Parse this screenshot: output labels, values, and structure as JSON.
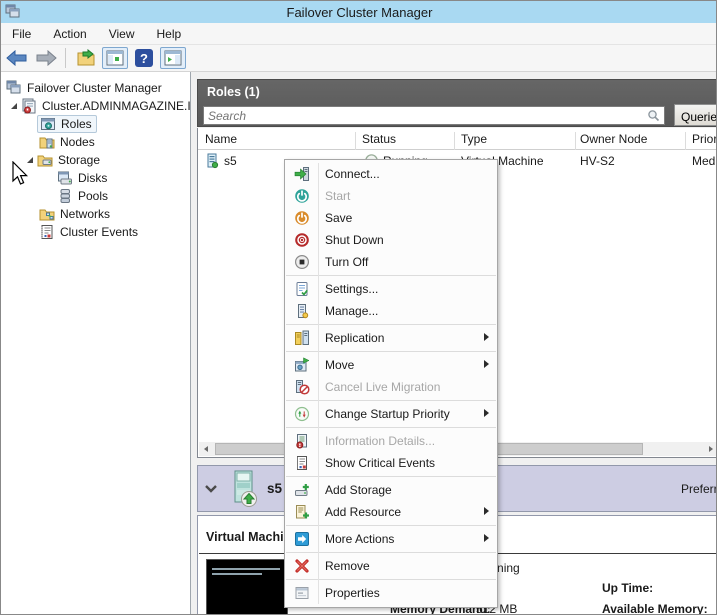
{
  "window": {
    "title": "Failover Cluster Manager"
  },
  "menubar": {
    "items": [
      {
        "label": "File"
      },
      {
        "label": "Action"
      },
      {
        "label": "View"
      },
      {
        "label": "Help"
      }
    ]
  },
  "toolbar": {
    "icon_names": [
      "back-arrow-icon",
      "forward-arrow-icon",
      "export-list-icon",
      "console-tree-icon",
      "help-icon",
      "action-pane-icon"
    ]
  },
  "tree": {
    "items": [
      {
        "label": "Failover Cluster Manager",
        "icon": "console-root-icon"
      },
      {
        "label": "Cluster.ADMINMAGAZINE.I",
        "icon": "cluster-icon",
        "expanded": true
      },
      {
        "label": "Roles",
        "icon": "roles-icon",
        "selected": true
      },
      {
        "label": "Nodes",
        "icon": "nodes-icon"
      },
      {
        "label": "Storage",
        "icon": "storage-icon",
        "expanded": true
      },
      {
        "label": "Disks",
        "icon": "disks-icon"
      },
      {
        "label": "Pools",
        "icon": "pools-icon"
      },
      {
        "label": "Networks",
        "icon": "networks-icon"
      },
      {
        "label": "Cluster Events",
        "icon": "cluster-events-icon"
      }
    ]
  },
  "main": {
    "panel_title": "Roles (1)",
    "search_placeholder": "Search",
    "queries_button": "Queries",
    "table": {
      "columns": [
        "Name",
        "Status",
        "Type",
        "Owner Node",
        "Priority"
      ],
      "rows": [
        {
          "name": "s5",
          "status": "Running",
          "type": "Virtual Machine",
          "owner_node": "HV-S2",
          "priority": "Medium"
        }
      ]
    }
  },
  "context_menu": {
    "items": [
      {
        "label": "Connect...",
        "icon": "connect-icon"
      },
      {
        "label": "Start",
        "icon": "start-icon",
        "disabled": true
      },
      {
        "label": "Save",
        "icon": "save-icon"
      },
      {
        "label": "Shut Down",
        "icon": "shut-down-icon"
      },
      {
        "label": "Turn Off",
        "icon": "turn-off-icon"
      },
      {
        "label": "Settings...",
        "icon": "settings-icon"
      },
      {
        "label": "Manage...",
        "icon": "manage-icon"
      },
      {
        "label": "Replication",
        "icon": "replication-icon",
        "submenu": true
      },
      {
        "label": "Move",
        "icon": "move-icon",
        "submenu": true
      },
      {
        "label": "Cancel Live Migration",
        "icon": "cancel-live-migration-icon",
        "disabled": true
      },
      {
        "label": "Change Startup Priority",
        "icon": "change-startup-priority-icon",
        "submenu": true
      },
      {
        "label": "Information Details...",
        "icon": "information-details-icon",
        "disabled": true
      },
      {
        "label": "Show Critical Events",
        "icon": "show-critical-events-icon"
      },
      {
        "label": "Add Storage",
        "icon": "add-storage-icon"
      },
      {
        "label": "Add Resource",
        "icon": "add-resource-icon",
        "submenu": true
      },
      {
        "label": "More Actions",
        "icon": "more-actions-icon",
        "submenu": true
      },
      {
        "label": "Remove",
        "icon": "remove-icon"
      },
      {
        "label": "Properties",
        "icon": "properties-icon"
      }
    ]
  },
  "details": {
    "header_title": "s5",
    "preferred_owners_label": "Preferred Owners:",
    "section_title": "Virtual Machine s5",
    "status_value": "Running",
    "up_time_label": "Up Time:",
    "memory_demand_label": "Memory Demand:",
    "memory_demand_value": "512 MB",
    "available_memory_label": "Available Memory:"
  },
  "icons": {
    "search-icon": "magnifier",
    "chevron-down-icon": "v",
    "submenu-arrow-icon": "▶",
    "tree-expander-icon": "◢"
  },
  "colors": {
    "titlebar": "#a9d9f2",
    "panel-header": "#666666",
    "details-header": "#cdcde3",
    "green": "#3fae49",
    "red": "#c03030",
    "teal": "#2fa39a",
    "orange": "#d98b2b",
    "disabled": "#a7a7a7"
  }
}
